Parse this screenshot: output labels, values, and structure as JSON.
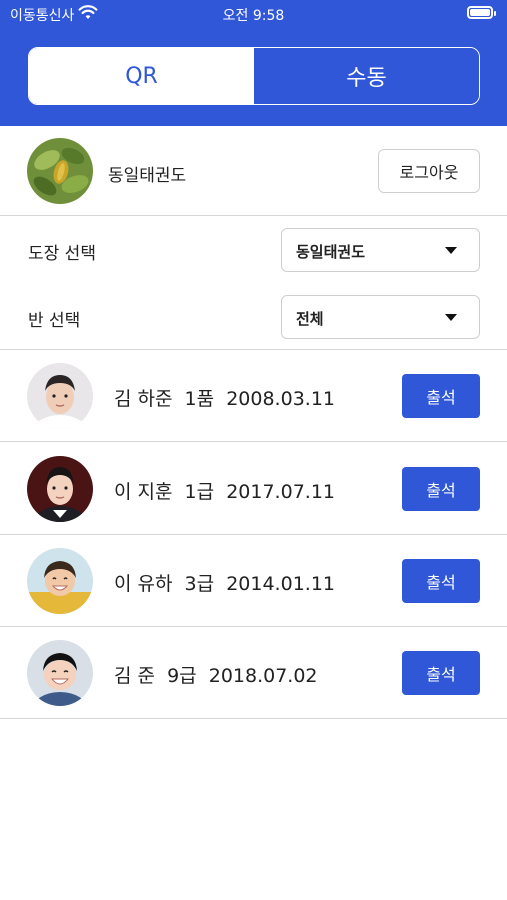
{
  "status_bar": {
    "carrier": "이동통신사",
    "time": "오전 9:58",
    "battery_level": 1.0
  },
  "mode_toggle": {
    "qr_label": "QR",
    "manual_label": "수동",
    "selected": "수동"
  },
  "profile": {
    "gym_name": "동일태권도",
    "logout_label": "로그아웃"
  },
  "filters": {
    "gym_select_label": "도장 선택",
    "gym_select_value": "동일태권도",
    "class_select_label": "반 선택",
    "class_select_value": "전체"
  },
  "students": [
    {
      "info": "김 하준  1품  2008.03.11",
      "action": "출석"
    },
    {
      "info": "이 지훈  1급  2017.07.11",
      "action": "출석"
    },
    {
      "info": "이 유하  3급  2014.01.11",
      "action": "출석"
    },
    {
      "info": "김 준  9급  2018.07.02",
      "action": "출석"
    }
  ],
  "colors": {
    "accent": "#2f57d8",
    "divider": "#d7d7d7",
    "background": "#ffffff"
  },
  "icons": [
    "wifi-icon",
    "battery-icon",
    "dropdown-caret-icon"
  ]
}
